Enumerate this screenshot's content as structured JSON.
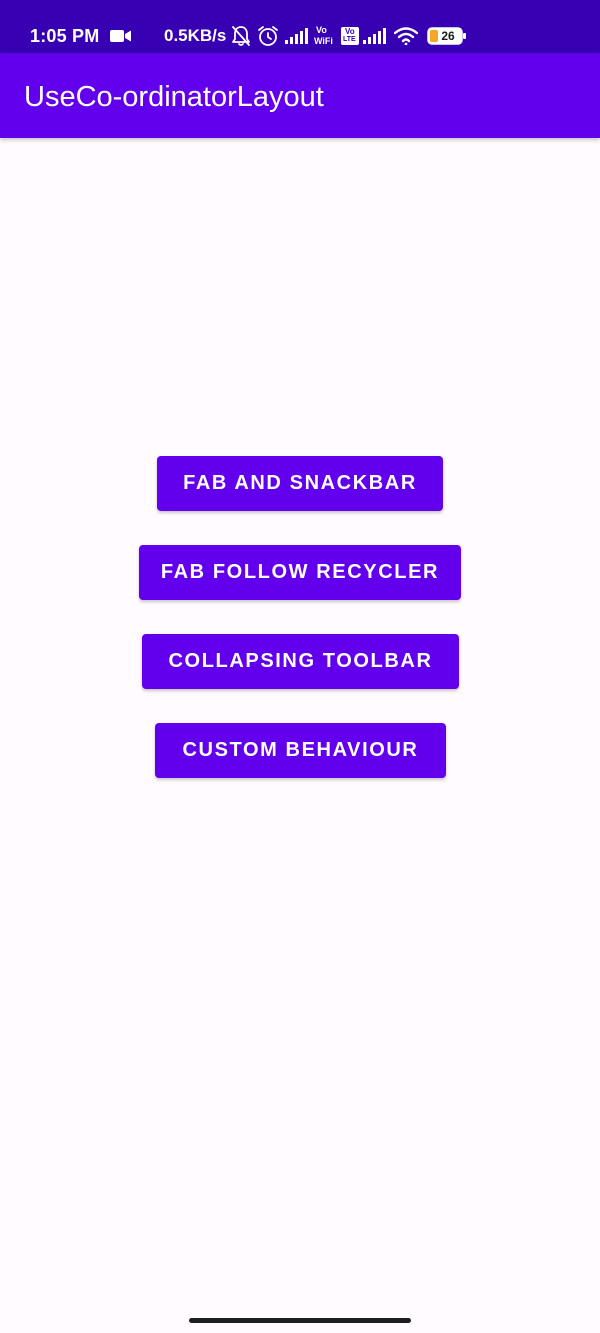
{
  "status_bar": {
    "time": "1:05 PM",
    "network_speed": "0.5KB/s",
    "battery_level": "26",
    "vowifi_top": "Vo",
    "vowifi_bottom": "WiFi",
    "volte_top": "Vo",
    "volte_bottom": "LTE",
    "icons": [
      "video-camera-icon",
      "bell-off-icon",
      "alarm-icon",
      "cell-signal-icon",
      "vowifi-icon",
      "volte-icon",
      "cell-signal-icon",
      "wifi-icon",
      "battery-icon"
    ],
    "background_color": "#3700B3"
  },
  "app_bar": {
    "title": "UseCo-ordinatorLayout",
    "background_color": "#6200EE"
  },
  "buttons": [
    {
      "label": "FAB AND SNACKBAR"
    },
    {
      "label": "FAB FOLLOW RECYCLER"
    },
    {
      "label": "COLLAPSING TOOLBAR"
    },
    {
      "label": "CUSTOM BEHAVIOUR"
    }
  ],
  "colors": {
    "primary": "#6200EE",
    "primary_dark": "#3700B3",
    "background": "#FFFBFE",
    "on_primary": "#FFFFFF"
  }
}
